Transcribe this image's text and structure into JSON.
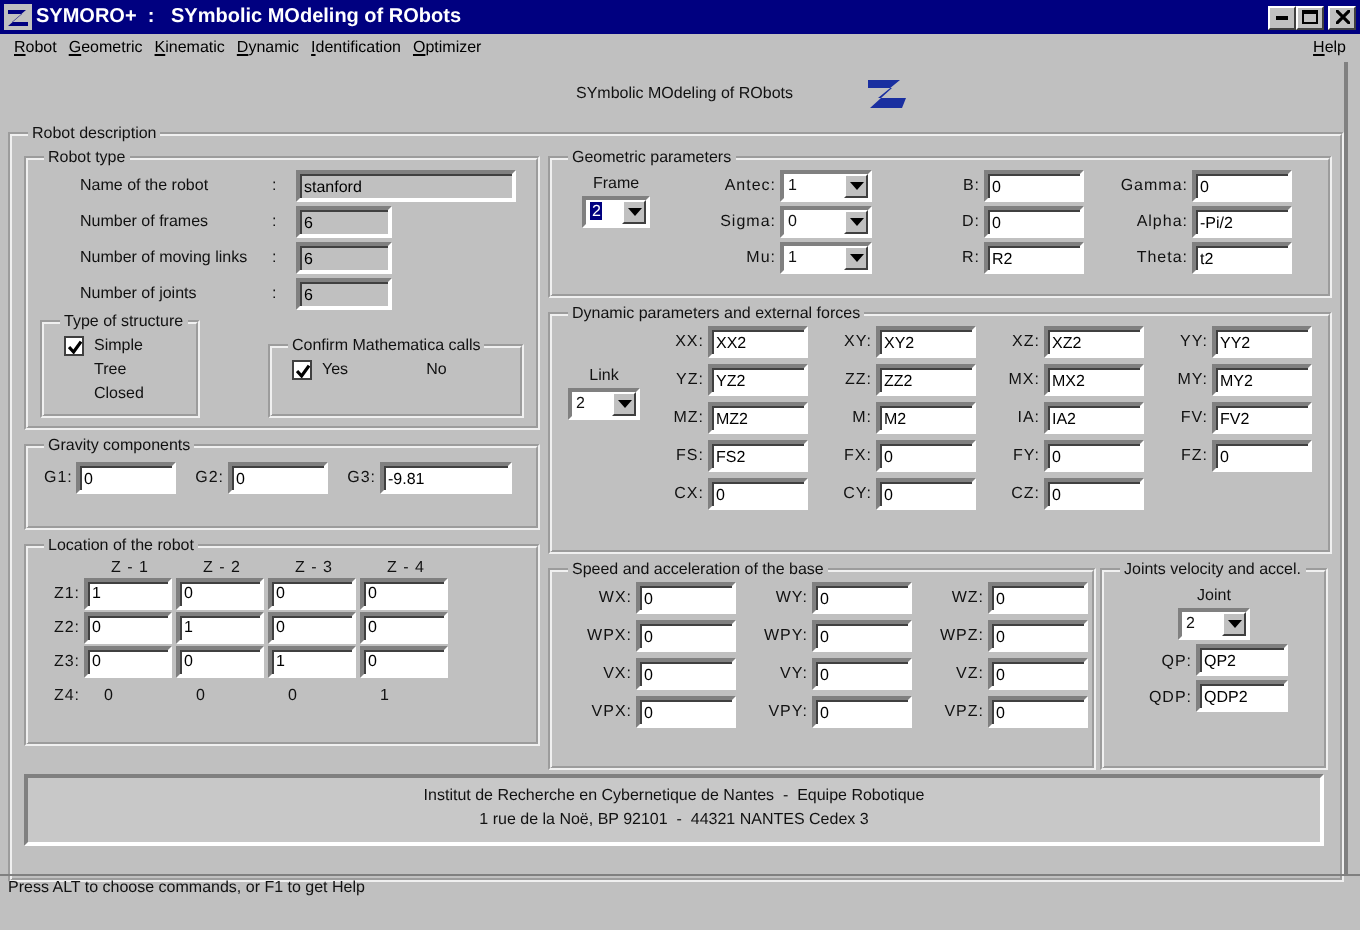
{
  "window": {
    "title": "SYMORO+  :   SYmbolic MOdeling of RObots"
  },
  "menu": [
    {
      "label": "Robot"
    },
    {
      "label": "Geometric"
    },
    {
      "label": "Kinematic"
    },
    {
      "label": "Dynamic"
    },
    {
      "label": "Identification"
    },
    {
      "label": "Optimizer"
    }
  ],
  "help_menu": {
    "label": "Help"
  },
  "header": {
    "title": "SYmbolic MOdeling of RObots"
  },
  "robot_description": {
    "title": "Robot description"
  },
  "robot_type": {
    "title": "Robot type",
    "fields": [
      {
        "label": "Name of the robot",
        "separator": ":",
        "value": "stanford",
        "disabled": true,
        "kind": "wide"
      },
      {
        "label": "Number of frames",
        "separator": ":",
        "value": "6",
        "disabled": true,
        "kind": "narrow"
      },
      {
        "label": "Number of moving links",
        "separator": ":",
        "value": "6",
        "disabled": true,
        "kind": "narrow"
      },
      {
        "label": "Number of joints",
        "separator": ":",
        "value": "6",
        "disabled": true,
        "kind": "narrow"
      }
    ],
    "structure": {
      "title": "Type of structure",
      "options": [
        {
          "label": "Simple",
          "selected": true
        },
        {
          "label": "Tree",
          "selected": false
        },
        {
          "label": "Closed",
          "selected": false
        }
      ]
    },
    "mathematica": {
      "title": "Confirm Mathematica calls",
      "options": [
        {
          "label": "Yes",
          "selected": true
        },
        {
          "label": "No",
          "selected": false
        }
      ]
    }
  },
  "gravity": {
    "title": "Gravity components",
    "fields": [
      {
        "label": "G1:",
        "value": "0"
      },
      {
        "label": "G2:",
        "value": "0"
      },
      {
        "label": "G3:",
        "value": "-9.81"
      }
    ]
  },
  "location": {
    "title": "Location of the robot",
    "columns": [
      "Z - 1",
      "Z - 2",
      "Z - 3",
      "Z - 4"
    ],
    "rows": [
      {
        "label": "Z1:",
        "kind": "input",
        "values": [
          "1",
          "0",
          "0",
          "0"
        ]
      },
      {
        "label": "Z2:",
        "kind": "input",
        "values": [
          "0",
          "1",
          "0",
          "0"
        ]
      },
      {
        "label": "Z3:",
        "kind": "input",
        "values": [
          "0",
          "0",
          "1",
          "0"
        ]
      },
      {
        "label": "Z4:",
        "kind": "text",
        "values": [
          "0",
          "0",
          "0",
          "1"
        ]
      }
    ]
  },
  "geometric": {
    "title": "Geometric parameters",
    "frame": {
      "label": "Frame",
      "value": "2",
      "highlighted": true
    },
    "combos": [
      {
        "label": "Antec:",
        "value": "1"
      },
      {
        "label": "Sigma:",
        "value": "0"
      },
      {
        "label": "Mu:",
        "value": "1"
      }
    ],
    "middle": [
      {
        "label": "B:",
        "value": "0"
      },
      {
        "label": "D:",
        "value": "0"
      },
      {
        "label": "R:",
        "value": "R2"
      }
    ],
    "right": [
      {
        "label": "Gamma:",
        "value": "0"
      },
      {
        "label": "Alpha:",
        "value": "-Pi/2"
      },
      {
        "label": "Theta:",
        "value": "t2"
      }
    ]
  },
  "dynamic": {
    "title": "Dynamic parameters and external forces",
    "link": {
      "label": "Link",
      "value": "2",
      "highlighted": false
    },
    "fields": [
      {
        "label": "XX:",
        "value": "XX2"
      },
      {
        "label": "XY:",
        "value": "XY2"
      },
      {
        "label": "XZ:",
        "value": "XZ2"
      },
      {
        "label": "YY:",
        "value": "YY2"
      },
      {
        "label": "YZ:",
        "value": "YZ2"
      },
      {
        "label": "ZZ:",
        "value": "ZZ2"
      },
      {
        "label": "MX:",
        "value": "MX2"
      },
      {
        "label": "MY:",
        "value": "MY2"
      },
      {
        "label": "MZ:",
        "value": "MZ2"
      },
      {
        "label": "M:",
        "value": "M2"
      },
      {
        "label": "IA:",
        "value": "IA2"
      },
      {
        "label": "FV:",
        "value": "FV2"
      },
      {
        "label": "FS:",
        "value": "FS2"
      },
      {
        "label": "FX:",
        "value": "0"
      },
      {
        "label": "FY:",
        "value": "0"
      },
      {
        "label": "FZ:",
        "value": "0"
      },
      {
        "label": "CX:",
        "value": "0"
      },
      {
        "label": "CY:",
        "value": "0"
      },
      {
        "label": "CZ:",
        "value": "0"
      }
    ]
  },
  "speed": {
    "title": "Speed and acceleration of the base",
    "fields": [
      {
        "label": "WX:",
        "value": "0"
      },
      {
        "label": "WY:",
        "value": "0"
      },
      {
        "label": "WZ:",
        "value": "0"
      },
      {
        "label": "WPX:",
        "value": "0"
      },
      {
        "label": "WPY:",
        "value": "0"
      },
      {
        "label": "WPZ:",
        "value": "0"
      },
      {
        "label": "VX:",
        "value": "0"
      },
      {
        "label": "VY:",
        "value": "0"
      },
      {
        "label": "VZ:",
        "value": "0"
      },
      {
        "label": "VPX:",
        "value": "0"
      },
      {
        "label": "VPY:",
        "value": "0"
      },
      {
        "label": "VPZ:",
        "value": "0"
      }
    ]
  },
  "joints": {
    "title": "Joints velocity and accel.",
    "joint": {
      "label": "Joint",
      "value": "2",
      "highlighted": false
    },
    "fields": [
      {
        "label": "QP:",
        "value": "QP2"
      },
      {
        "label": "QDP:",
        "value": "QDP2"
      }
    ]
  },
  "footer": {
    "lines": [
      "Institut de Recherche en Cybernetique de Nantes  -  Equipe Robotique",
      "1 rue de la Noë, BP 92101  -  44321 NANTES Cedex 3"
    ]
  },
  "status_bar": {
    "text": "Press ALT to choose commands, or F1 to get Help"
  }
}
